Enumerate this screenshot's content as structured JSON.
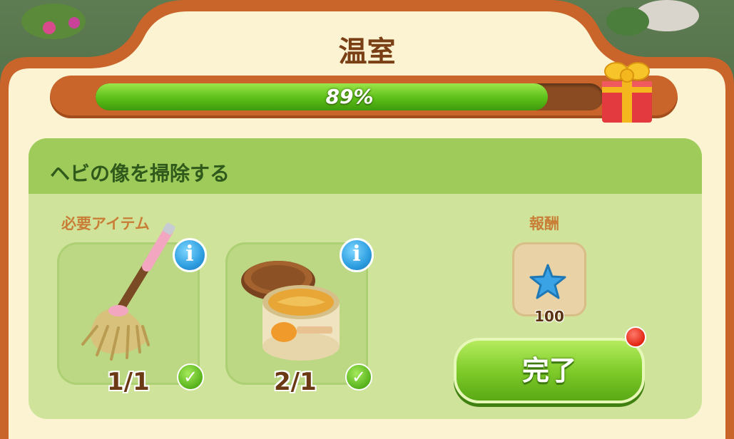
{
  "dialog": {
    "title": "温室",
    "progress_text": "89%",
    "progress_fraction": 0.89
  },
  "task": {
    "title": "ヘビの像を掃除する",
    "required_label": "必要アイテム",
    "reward_label": "報酬",
    "items": [
      {
        "name": "mop",
        "count": "1/1",
        "icon": "mop-icon"
      },
      {
        "name": "polish-jar",
        "count": "2/1",
        "icon": "polish-jar-icon"
      }
    ],
    "reward_amount": "100",
    "reward_icon": "blue-star-icon",
    "complete_label": "完了"
  },
  "colors": {
    "frame": "#c9642a",
    "panel": "#fbf3d2",
    "progress_fill": "#5cbf18",
    "task_card": "#cfe49a",
    "button": "#7fcc2a"
  }
}
